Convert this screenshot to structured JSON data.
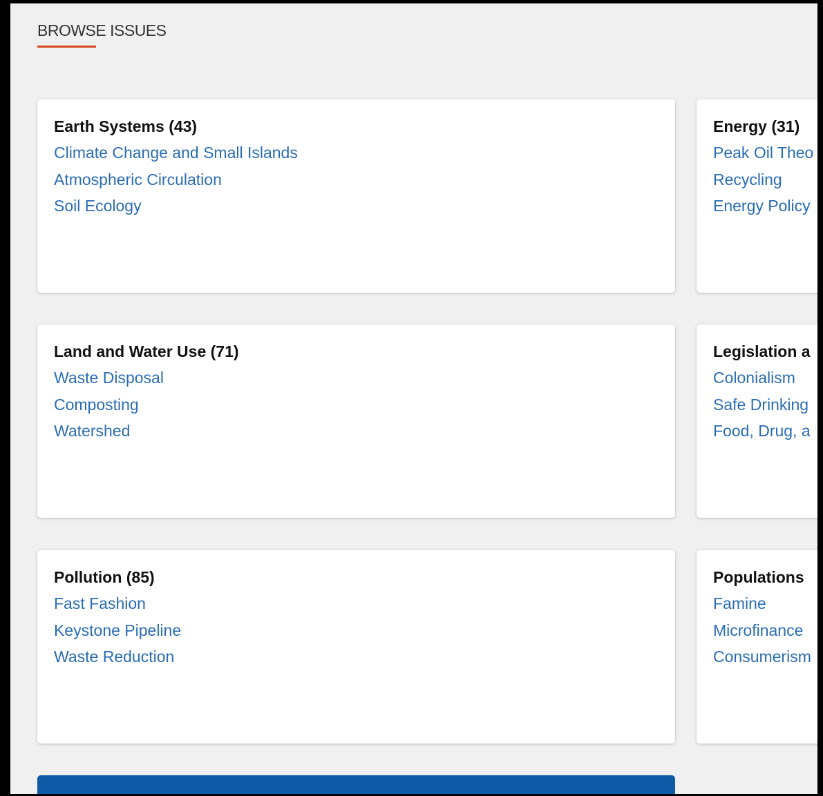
{
  "section": {
    "title": "BROWSE ISSUES"
  },
  "cards": [
    {
      "heading": "Earth Systems (43)",
      "links": [
        "Climate Change and Small Islands",
        "Atmospheric Circulation",
        "Soil Ecology"
      ]
    },
    {
      "heading": "Energy (31)",
      "links": [
        "Peak Oil Theo",
        "Recycling",
        "Energy Policy"
      ]
    },
    {
      "heading": "Land and Water Use (71)",
      "links": [
        "Waste Disposal",
        "Composting",
        "Watershed"
      ]
    },
    {
      "heading": "Legislation a",
      "links": [
        "Colonialism",
        "Safe Drinking",
        "Food, Drug, a"
      ]
    },
    {
      "heading": "Pollution (85)",
      "links": [
        "Fast Fashion",
        "Keystone Pipeline",
        "Waste Reduction"
      ]
    },
    {
      "heading": "Populations",
      "links": [
        "Famine",
        "Microfinance",
        "Consumerism"
      ]
    }
  ],
  "colors": {
    "accent_underline": "#d6471e",
    "link": "#2a6db5",
    "footer_bar": "#0e5aa7",
    "background": "#f0f0f0"
  }
}
